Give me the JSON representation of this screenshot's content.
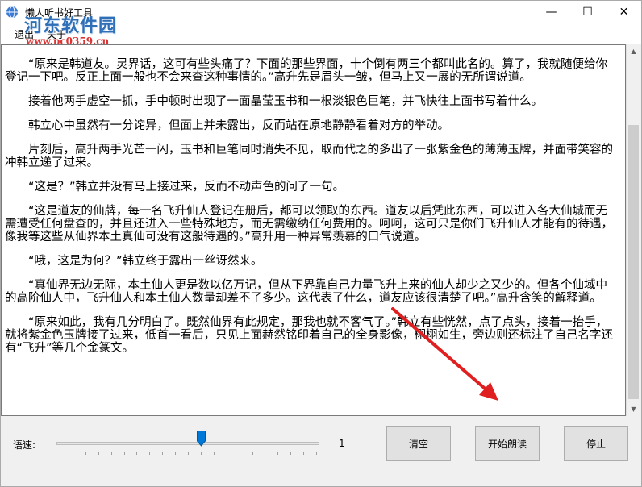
{
  "window": {
    "title": "懒人听书好工具",
    "icon": "globe-icon",
    "minimize": "—",
    "maximize": "☐",
    "close": "✕"
  },
  "menu": {
    "items": [
      "退出",
      "关于"
    ]
  },
  "watermark": {
    "line1": "河东软件园",
    "line2": "www.pc0359.cn"
  },
  "content": {
    "paragraphs": [
      "“原来是韩道友。灵界话，这可有些头痛了？下面的那些界面，十个倒有两三个都叫此名的。算了，我就随便给你登记一下吧。反正上面一般也不会来查这种事情的。”高升先是眉头一皱，但马上又一展的无所谓说道。",
      "接着他两手虚空一抓，手中顿时出现了一面晶莹玉书和一根淡银色巨笔，并飞快往上面书写着什么。",
      "韩立心中虽然有一分诧异，但面上并未露出，反而站在原地静静看着对方的举动。",
      "片刻后，高升两手光芒一闪，玉书和巨笔同时消失不见，取而代之的多出了一张紫金色的薄薄玉牌，并面带笑容的冲韩立递了过来。",
      "“这是？”韩立并没有马上接过来，反而不动声色的问了一句。",
      "“这是道友的仙牌，每一名飞升仙人登记在册后，都可以领取的东西。道友以后凭此东西，可以进入各大仙城而无需遭受任何盘查的，并且还进入一些特殊地方，而无需缴纳任何费用的。呵呵，这可只是你们飞升仙人才能有的待遇，像我等这些从仙界本土真仙可没有这般待遇的。”高升用一种异常羡慕的口气说道。",
      "“哦，这是为何？”韩立终于露出一丝讶然来。",
      "“真仙界无边无际，本土仙人更是数以亿万记，但从下界靠自己力量飞升上来的仙人却少之又少的。但各个仙域中的高阶仙人中，飞升仙人和本土仙人数量却差不了多少。这代表了什么，道友应该很清楚了吧。”高升含笑的解释道。",
      "“原来如此，我有几分明白了。既然仙界有此规定，那我也就不客气了。”韩立有些恍然，点了点头，接着一抬手，就将紫金色玉牌接了过来，低首一看后，只见上面赫然铭印着自己的全身影像，栩栩如生，旁边则还标注了自己名字还有“飞升”等几个金篆文。"
    ]
  },
  "controls": {
    "speed_label": "语速:",
    "speed_value": "1",
    "speed_level": 0.55,
    "clear_label": "清空",
    "start_label": "开始朗读",
    "stop_label": "停止"
  },
  "annotation": {
    "arrow_color": "#e02020"
  }
}
